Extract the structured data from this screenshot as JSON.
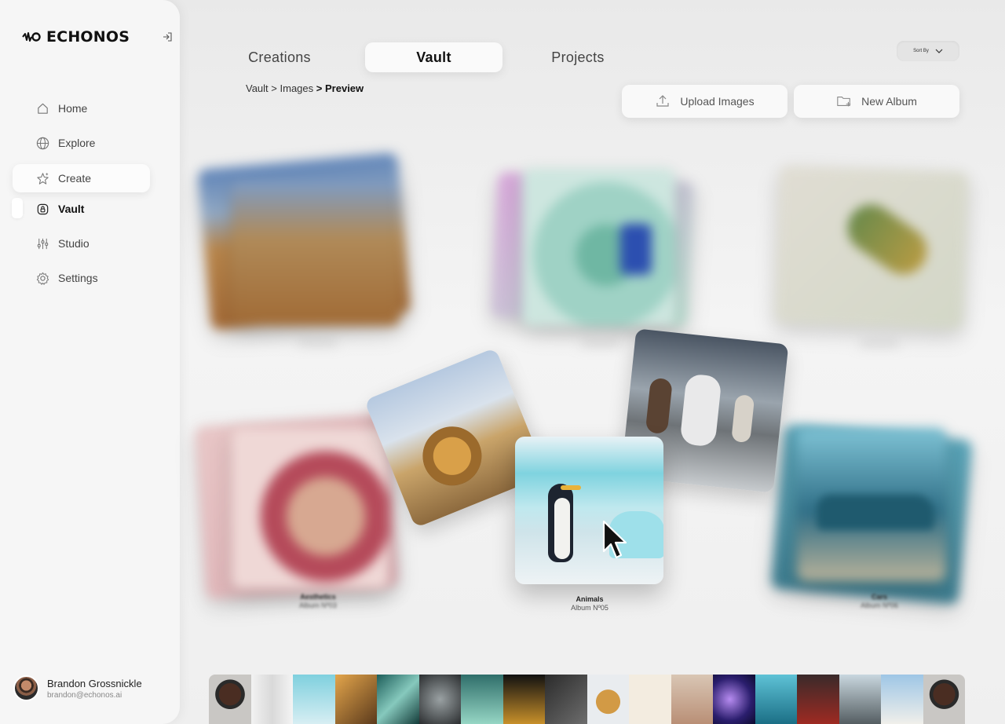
{
  "brand": {
    "name": "ECHONOS"
  },
  "sidebar": {
    "items": [
      {
        "label": "Home",
        "icon": "home-icon"
      },
      {
        "label": "Explore",
        "icon": "globe-icon"
      },
      {
        "label": "Create",
        "icon": "sparkle-star-icon"
      },
      {
        "label": "Vault",
        "icon": "vault-lock-icon"
      },
      {
        "label": "Studio",
        "icon": "sliders-icon"
      },
      {
        "label": "Settings",
        "icon": "gear-icon"
      }
    ],
    "hovered": "Create",
    "active": "Vault"
  },
  "user": {
    "name": "Brandon Grossnickle",
    "email": "brandon@echonos.ai"
  },
  "tabs": [
    {
      "label": "Creations"
    },
    {
      "label": "Vault"
    },
    {
      "label": "Projects"
    }
  ],
  "active_tab": "Vault",
  "sort": {
    "label": "Sort By"
  },
  "breadcrumb": {
    "part1": "Vault",
    "sep": ">",
    "part2": "Images",
    "current": "Preview"
  },
  "actions": {
    "upload_label": "Upload Images",
    "new_album_label": "New Album"
  },
  "albums": {
    "aesthetics": {
      "title": "Aesthetics",
      "subtitle": "Album Nº03"
    },
    "animals": {
      "title": "Animals",
      "subtitle": "Album Nº05"
    },
    "cars": {
      "title": "Cars",
      "subtitle": "Album Nº06"
    }
  },
  "colors": {
    "accent": "#111111",
    "background": "#efefef",
    "sidebar": "#f6f6f6"
  }
}
